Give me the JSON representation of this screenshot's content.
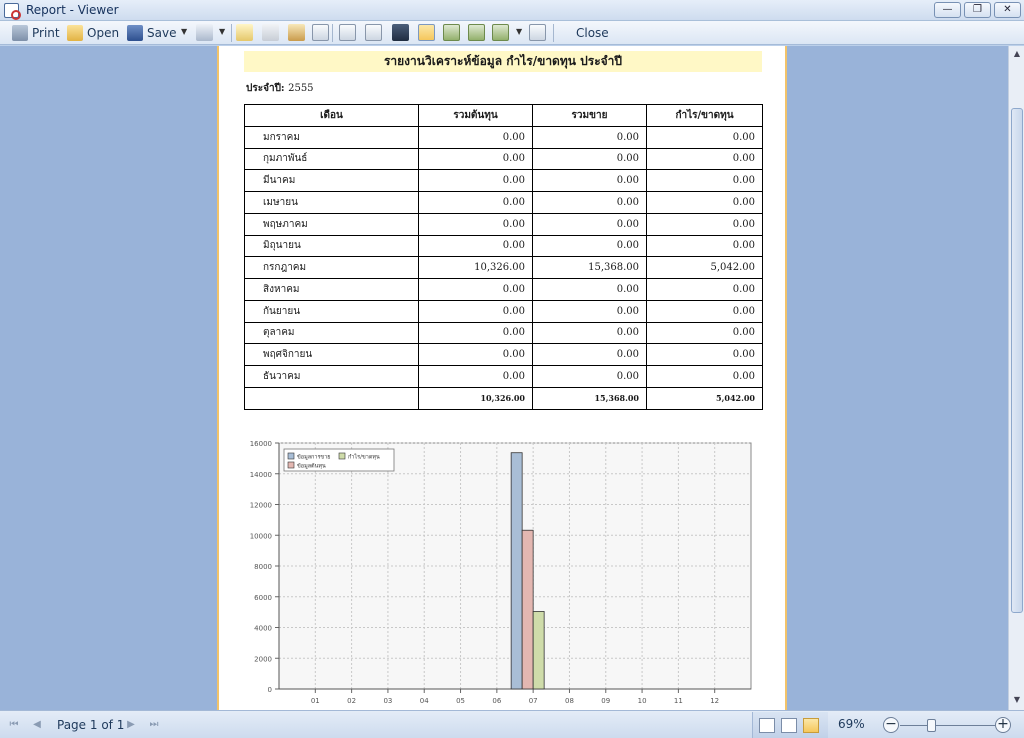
{
  "window": {
    "title": "Report - Viewer"
  },
  "toolbar": {
    "print_label": "Print",
    "open_label": "Open",
    "save_label": "Save",
    "close_label": "Close"
  },
  "report": {
    "title": "รายงานวิเคราะห์ข้อมูล กำไร/ขาดทุน ประจำปี",
    "year_label": "ประจำปี:",
    "year_value": "2555",
    "columns": [
      "เดือน",
      "รวมต้นทุน",
      "รวมขาย",
      "กำไร/ขาดทุน"
    ],
    "rows": [
      {
        "month": "มกราคม",
        "cost": "0.00",
        "sales": "0.00",
        "profit": "0.00"
      },
      {
        "month": "กุมภาพันธ์",
        "cost": "0.00",
        "sales": "0.00",
        "profit": "0.00"
      },
      {
        "month": "มีนาคม",
        "cost": "0.00",
        "sales": "0.00",
        "profit": "0.00"
      },
      {
        "month": "เมษายน",
        "cost": "0.00",
        "sales": "0.00",
        "profit": "0.00"
      },
      {
        "month": "พฤษภาคม",
        "cost": "0.00",
        "sales": "0.00",
        "profit": "0.00"
      },
      {
        "month": "มิถุนายน",
        "cost": "0.00",
        "sales": "0.00",
        "profit": "0.00"
      },
      {
        "month": "กรกฎาคม",
        "cost": "10,326.00",
        "sales": "15,368.00",
        "profit": "5,042.00"
      },
      {
        "month": "สิงหาคม",
        "cost": "0.00",
        "sales": "0.00",
        "profit": "0.00"
      },
      {
        "month": "กันยายน",
        "cost": "0.00",
        "sales": "0.00",
        "profit": "0.00"
      },
      {
        "month": "ตุลาคม",
        "cost": "0.00",
        "sales": "0.00",
        "profit": "0.00"
      },
      {
        "month": "พฤศจิกายน",
        "cost": "0.00",
        "sales": "0.00",
        "profit": "0.00"
      },
      {
        "month": "ธันวาคม",
        "cost": "0.00",
        "sales": "0.00",
        "profit": "0.00"
      }
    ],
    "totals": {
      "label": "",
      "cost": "10,326.00",
      "sales": "15,368.00",
      "profit": "5,042.00"
    }
  },
  "chart_data": {
    "type": "bar",
    "title": "",
    "xlabel": "",
    "ylabel": "",
    "categories": [
      "01",
      "02",
      "03",
      "04",
      "05",
      "06",
      "07",
      "08",
      "09",
      "10",
      "11",
      "12"
    ],
    "series": [
      {
        "name": "ข้อมูลการขาย",
        "color": "#a9bed6",
        "values": [
          0,
          0,
          0,
          0,
          0,
          0,
          15368,
          0,
          0,
          0,
          0,
          0
        ]
      },
      {
        "name": "ข้อมูลต้นทุน",
        "color": "#e3b7b1",
        "values": [
          0,
          0,
          0,
          0,
          0,
          0,
          10326,
          0,
          0,
          0,
          0,
          0
        ]
      },
      {
        "name": "กำไร/ขาดทุน",
        "color": "#cfdcaa",
        "values": [
          0,
          0,
          0,
          0,
          0,
          0,
          5042,
          0,
          0,
          0,
          0,
          0
        ]
      }
    ],
    "ylim": [
      0,
      16000
    ],
    "yticks": [
      0,
      2000,
      4000,
      6000,
      8000,
      10000,
      12000,
      14000,
      16000
    ],
    "grid": true,
    "legend_position": "top-left"
  },
  "statusbar": {
    "page_indicator": "Page 1 of 1",
    "zoom": "69%"
  }
}
